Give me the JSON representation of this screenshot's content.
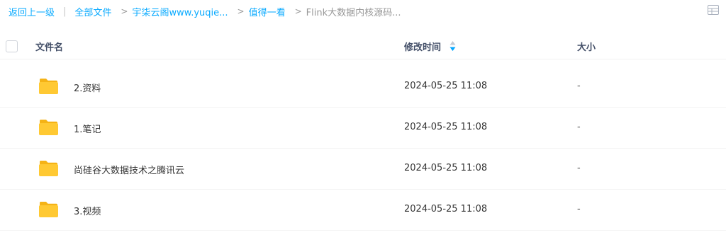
{
  "breadcrumb": {
    "back": "返回上一级",
    "items": [
      "全部文件",
      "宇柒云阁www.yuqie...",
      "值得一看",
      "Flink大数据内核源码..."
    ]
  },
  "table": {
    "headers": {
      "name": "文件名",
      "mtime": "修改时间",
      "size": "大小"
    },
    "rows": [
      {
        "name": "2.资料",
        "time": "2024-05-25 11:08",
        "size": "-"
      },
      {
        "name": "1.笔记",
        "time": "2024-05-25 11:08",
        "size": "-"
      },
      {
        "name": "尚硅谷大数据技术之腾讯云",
        "time": "2024-05-25 11:08",
        "size": "-"
      },
      {
        "name": "3.视频",
        "time": "2024-05-25 11:08",
        "size": "-"
      }
    ]
  },
  "icons": {
    "view_toggle": "grid-view-icon",
    "sort": "sort-icon",
    "folder": "folder-icon"
  },
  "colors": {
    "link": "#09aaff",
    "folder": "#ffc933",
    "sort_active": "#06a7ff"
  }
}
